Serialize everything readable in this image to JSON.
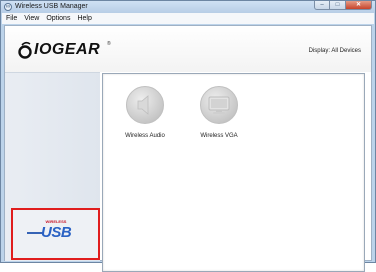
{
  "window": {
    "title": "Wireless USB Manager",
    "controls": {
      "minimize": "–",
      "maximize": "□",
      "close": "✕"
    }
  },
  "menu": {
    "items": [
      "File",
      "View",
      "Options",
      "Help"
    ]
  },
  "header": {
    "brand": "IOGEAR",
    "trademark": "®",
    "display_filter": "Display: All Devices"
  },
  "devices": [
    {
      "label": "Wireless Audio",
      "icon": "speaker-icon"
    },
    {
      "label": "Wireless VGA",
      "icon": "monitor-icon"
    }
  ],
  "sidebar": {
    "usb_logo_small": "WIRELESS",
    "usb_logo_text": "USB"
  },
  "colors": {
    "highlight_border": "#e01d1d",
    "usb_blue": "#2a62c4",
    "usb_red": "#c8182b"
  }
}
